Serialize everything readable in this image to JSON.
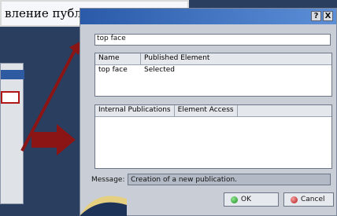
{
  "caption": {
    "text": "вление публикацией"
  },
  "dialog": {
    "title_buttons": [
      "?",
      "X"
    ],
    "field_value": "top face",
    "published_table": {
      "headers": [
        "Name",
        "Published Element"
      ],
      "rows": [
        {
          "name": "top face",
          "element": "Selected"
        }
      ]
    },
    "tabs": [
      "Internal Publications",
      "Element Access"
    ],
    "message_label": "Message:",
    "message_text": "Creation of a new publication.",
    "ok_label": "OK",
    "cancel_label": "Cancel"
  },
  "colors": {
    "arrow": "#8b1414",
    "background": "#2a3f60",
    "titlebar": "#2a5aa8"
  }
}
